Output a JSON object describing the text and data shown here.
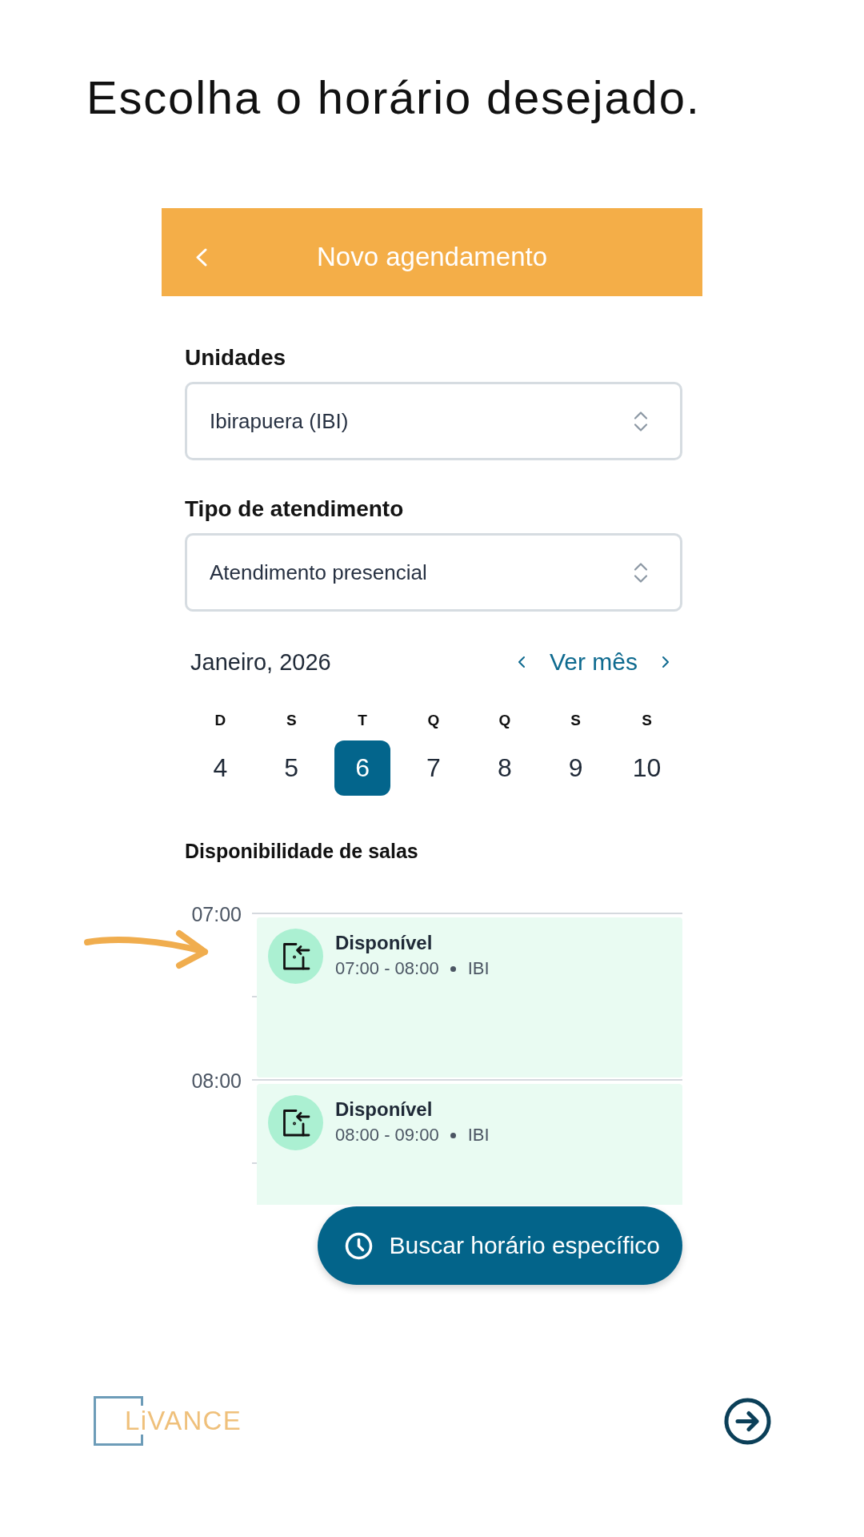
{
  "heading": "Escolha o horário desejado.",
  "app_bar": {
    "title": "Novo agendamento"
  },
  "fields": [
    {
      "label": "Unidades",
      "value": "Ibirapuera (IBI)"
    },
    {
      "label": "Tipo de atendimento",
      "value": "Atendimento presencial"
    }
  ],
  "calendar": {
    "month": "Janeiro, 2026",
    "view_link": "Ver mês",
    "days": [
      {
        "weekday": "D",
        "date": "4",
        "selected": false
      },
      {
        "weekday": "S",
        "date": "5",
        "selected": false
      },
      {
        "weekday": "T",
        "date": "6",
        "selected": true
      },
      {
        "weekday": "Q",
        "date": "7",
        "selected": false
      },
      {
        "weekday": "Q",
        "date": "8",
        "selected": false
      },
      {
        "weekday": "S",
        "date": "9",
        "selected": false
      },
      {
        "weekday": "S",
        "date": "10",
        "selected": false
      }
    ]
  },
  "availability": {
    "title": "Disponibilidade de salas",
    "hours": [
      {
        "time": "07:00",
        "slot": {
          "status": "Disponível",
          "range": "07:00 - 08:00",
          "unit": "IBI"
        }
      },
      {
        "time": "08:00",
        "slot": {
          "status": "Disponível",
          "range": "08:00 - 09:00",
          "unit": "IBI"
        }
      }
    ]
  },
  "action_button": {
    "label": "Buscar horário específico"
  },
  "footer": {
    "logo": "LiVANCE"
  }
}
